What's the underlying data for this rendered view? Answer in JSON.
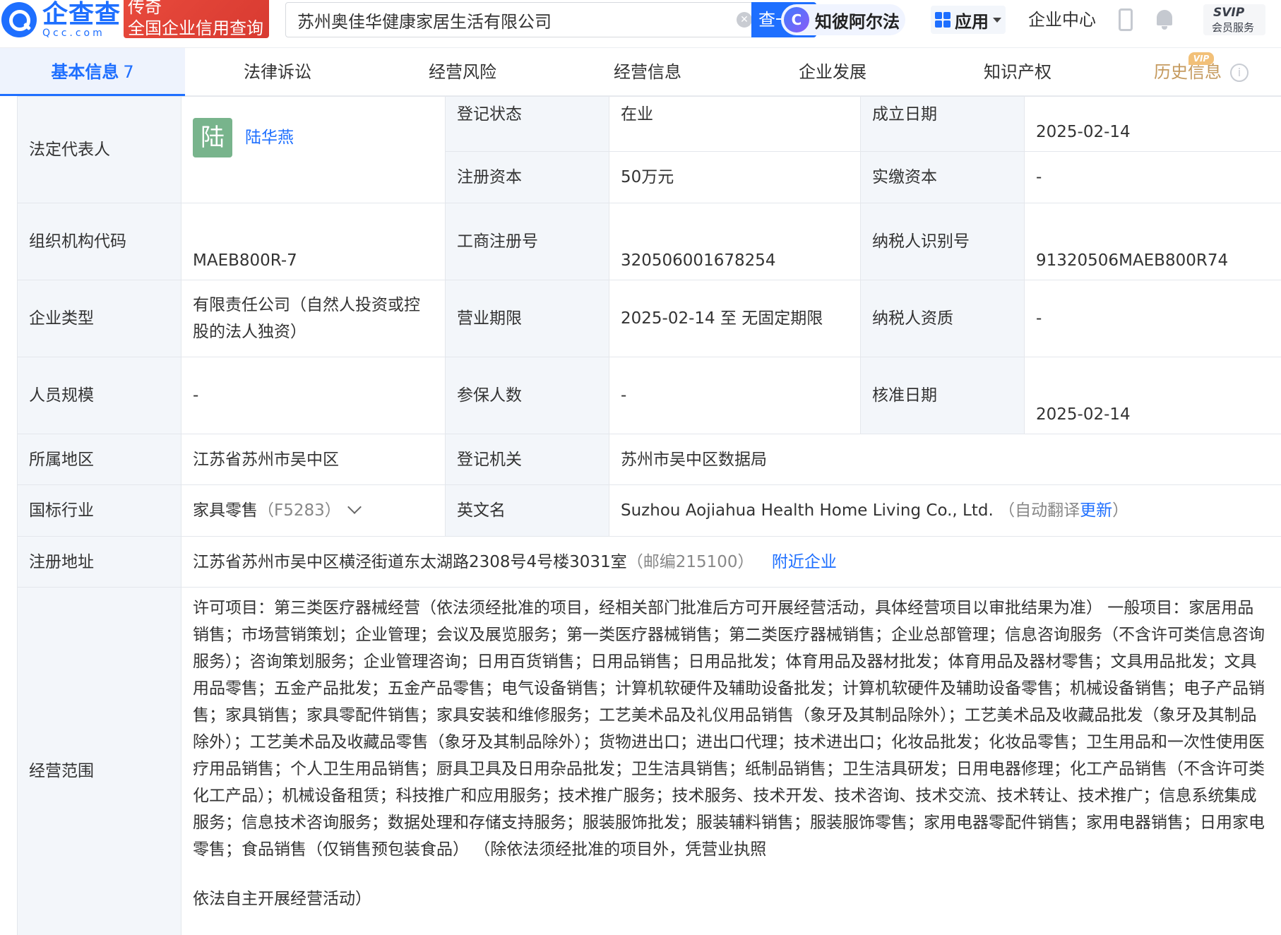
{
  "header": {
    "logo_cn": "企查查",
    "logo_en": "Qcc.com",
    "promo_line1": "传奇",
    "promo_line2": "全国企业信用查询",
    "search_value": "苏州奥佳华健康家居生活有限公司",
    "search_button": "查一下",
    "ai_logo": "C",
    "ai_label": "知彼阿尔法",
    "apps_label": "应用",
    "enterprise_center": "企业中心",
    "svip_line1": "SVIP",
    "svip_line2": "会员服务"
  },
  "tabs": {
    "basic": "基本信息",
    "basic_count": "7",
    "legal": "法律诉讼",
    "risk": "经营风险",
    "operation": "经营信息",
    "development": "企业发展",
    "ip": "知识产权",
    "history": "历史信息",
    "vip_badge": "VIP",
    "info_icon": "i"
  },
  "info": {
    "legal_rep_label": "法定代表人",
    "legal_rep_avatar": "陆",
    "legal_rep_name": "陆华燕",
    "reg_status_label": "登记状态",
    "reg_status": "在业",
    "found_date_label": "成立日期",
    "found_date": "2025-02-14",
    "reg_capital_label": "注册资本",
    "reg_capital": "50万元",
    "paid_capital_label": "实缴资本",
    "paid_capital": "-",
    "org_code_label": "组织机构代码",
    "org_code": "MAEB800R-7",
    "biz_reg_no_label": "工商注册号",
    "biz_reg_no": "320506001678254",
    "taxpayer_id_label": "纳税人识别号",
    "taxpayer_id": "91320506MAEB800R74",
    "company_type_label": "企业类型",
    "company_type": "有限责任公司（自然人投资或控股的法人独资）",
    "term_label": "营业期限",
    "term": "2025-02-14 至 无固定期限",
    "taxpayer_qual_label": "纳税人资质",
    "taxpayer_qual": "-",
    "staff_size_label": "人员规模",
    "staff_size": "-",
    "insured_label": "参保人数",
    "insured": "-",
    "approval_date_label": "核准日期",
    "approval_date": "2025-02-14",
    "region_label": "所属地区",
    "region": "江苏省苏州市吴中区",
    "reg_authority_label": "登记机关",
    "reg_authority": "苏州市吴中区数据局",
    "industry_label": "国标行业",
    "industry": "家具零售",
    "industry_code": "（F5283）",
    "en_name_label": "英文名",
    "en_name": "Suzhou Aojiahua Health Home Living Co., Ltd.",
    "en_name_note_open": "（自动翻译",
    "en_name_update": "更新",
    "en_name_note_close": "）",
    "address_label": "注册地址",
    "address": "江苏省苏州市吴中区横泾街道东太湖路2308号4号楼3031室",
    "postcode": "（邮编215100）",
    "nearby": "附近企业",
    "scope_label": "经营范围",
    "scope": "许可项目：第三类医疗器械经营（依法须经批准的项目，经相关部门批准后方可开展经营活动，具体经营项目以审批结果为准） 一般项目：家居用品销售；市场营销策划；企业管理；会议及展览服务；第一类医疗器械销售；第二类医疗器械销售；企业总部管理；信息咨询服务（不含许可类信息咨询服务）；咨询策划服务；企业管理咨询；日用百货销售；日用品销售；日用品批发；体育用品及器材批发；体育用品及器材零售；文具用品批发；文具用品零售；五金产品批发；五金产品零售；电气设备销售；计算机软硬件及辅助设备批发；计算机软硬件及辅助设备零售；机械设备销售；电子产品销售；家具销售；家具零配件销售；家具安装和维修服务；工艺美术品及礼仪用品销售（象牙及其制品除外）；工艺美术品及收藏品批发（象牙及其制品除外）；工艺美术品及收藏品零售（象牙及其制品除外）；货物进出口；进出口代理；技术进出口；化妆品批发；化妆品零售；卫生用品和一次性使用医疗用品销售；个人卫生用品销售；厨具卫具及日用杂品批发；卫生洁具销售；纸制品销售；卫生洁具研发；日用电器修理；化工产品销售（不含许可类化工产品）；机械设备租赁；科技推广和应用服务；技术推广服务；技术服务、技术开发、技术咨询、技术交流、技术转让、技术推广；信息系统集成服务；信息技术咨询服务；数据处理和存储支持服务；服装服饰批发；服装辅料销售；服装服饰零售；家用电器零配件销售；家用电器销售；日用家电零售；食品销售（仅销售预包装食品） （除依法须经批准的项目外，凭营业执照",
    "scope_tail": "依法自主开展经营活动）"
  }
}
